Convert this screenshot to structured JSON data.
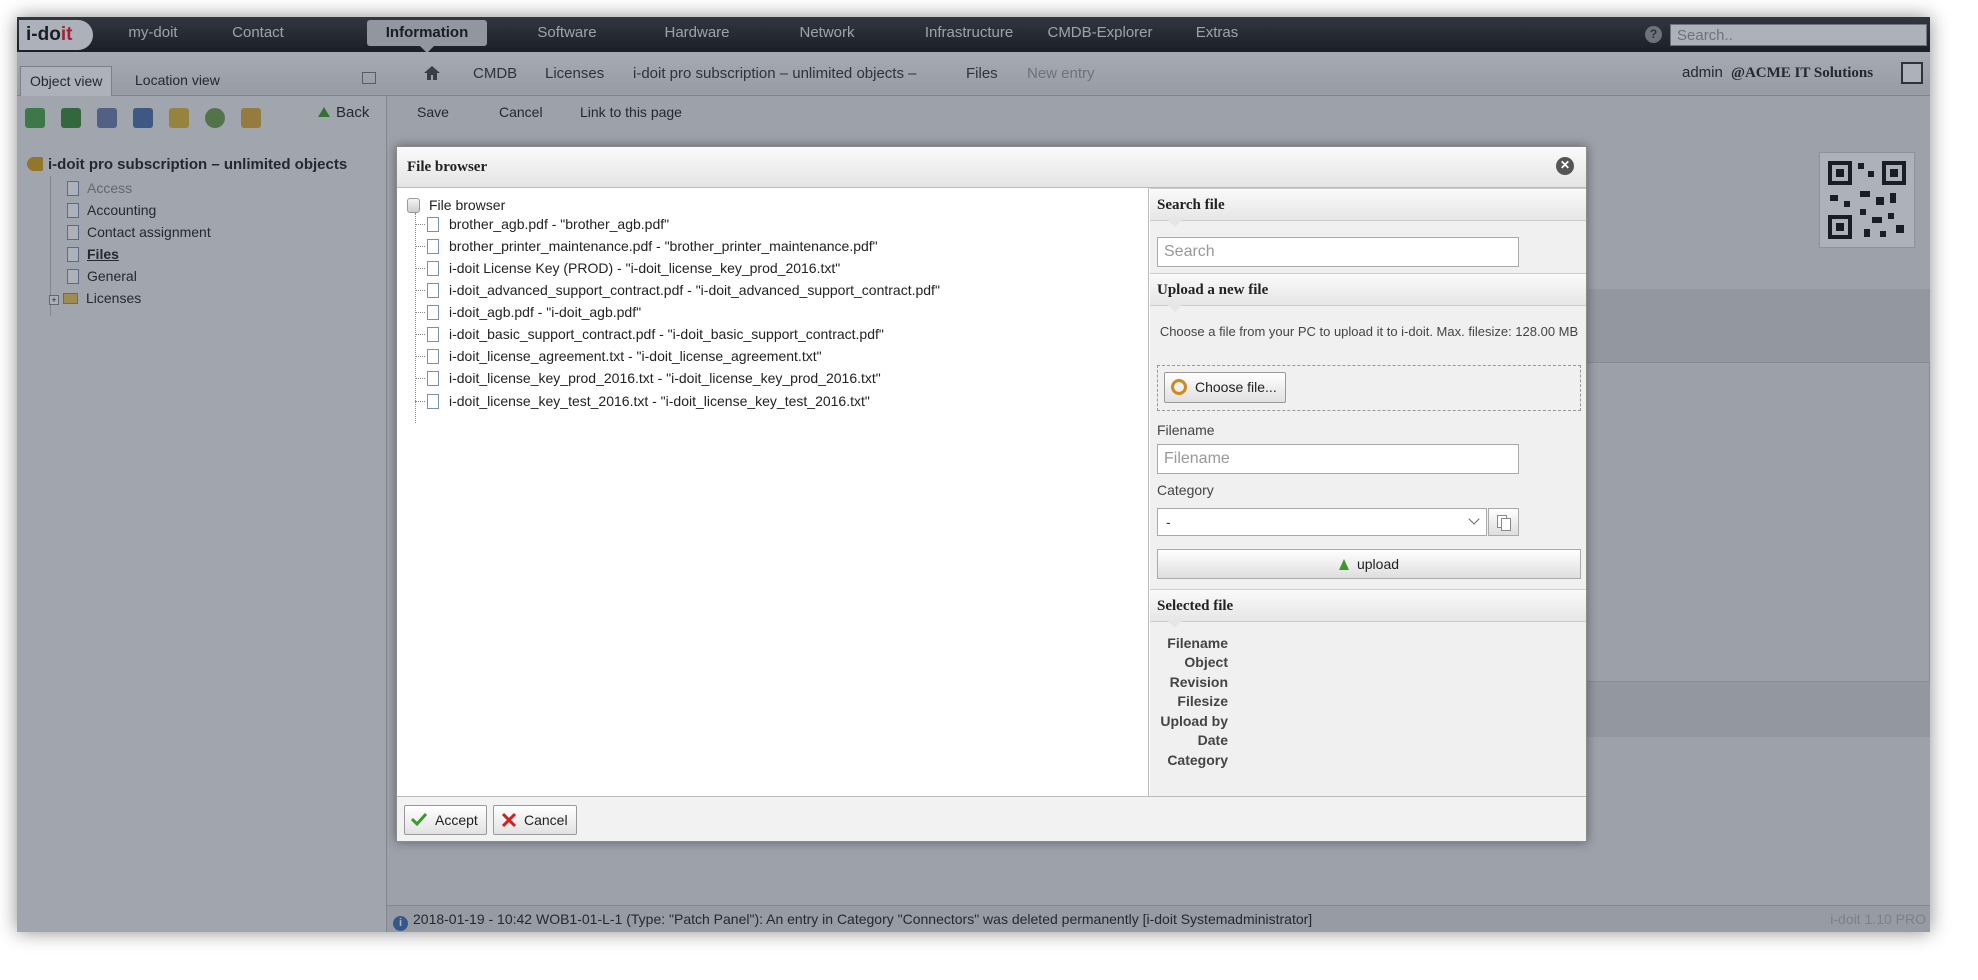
{
  "app": {
    "logo_prefix": "i-do",
    "logo_suffix": "it"
  },
  "topnav": {
    "items": [
      "my-doit",
      "Contact",
      "Information",
      "Software",
      "Hardware",
      "Network",
      "Infrastructure",
      "CMDB-Explorer",
      "Extras"
    ],
    "active": "Information",
    "search_placeholder": "Search.."
  },
  "tabs": {
    "object_view": "Object view",
    "location_view": "Location view"
  },
  "breadcrumb": [
    "CMDB",
    "Licenses",
    "i-doit pro subscription – unlimited objects –",
    "Files",
    "New entry"
  ],
  "user": {
    "name": "admin",
    "tenant": "@ACME IT Solutions"
  },
  "sidebar": {
    "back_label": "Back",
    "root_label": "i-doit pro subscription – unlimited objects",
    "items": [
      {
        "label": "Access",
        "state": "muted"
      },
      {
        "label": "Accounting",
        "state": "normal"
      },
      {
        "label": "Contact assignment",
        "state": "normal"
      },
      {
        "label": "Files",
        "state": "active"
      },
      {
        "label": "General",
        "state": "normal"
      },
      {
        "label": "Licenses",
        "state": "folder"
      }
    ]
  },
  "actions": {
    "save": "Save",
    "cancel": "Cancel",
    "link": "Link to this page"
  },
  "statusbar": {
    "message": "2018-01-19 - 10:42 WOB1-01-L-1 (Type: \"Patch Panel\"): An entry in Category \"Connectors\" was deleted permanently [i-doit Systemadministrator]",
    "version": "i-doit 1.10 PRO"
  },
  "dialog": {
    "title": "File browser",
    "root_label": "File browser",
    "files": [
      "brother_agb.pdf - \"brother_agb.pdf\"",
      "brother_printer_maintenance.pdf - \"brother_printer_maintenance.pdf\"",
      "i-doit License Key (PROD) - \"i-doit_license_key_prod_2016.txt\"",
      "i-doit_advanced_support_contract.pdf - \"i-doit_advanced_support_contract.pdf\"",
      "i-doit_agb.pdf - \"i-doit_agb.pdf\"",
      "i-doit_basic_support_contract.pdf - \"i-doit_basic_support_contract.pdf\"",
      "i-doit_license_agreement.txt - \"i-doit_license_agreement.txt\"",
      "i-doit_license_key_prod_2016.txt - \"i-doit_license_key_prod_2016.txt\"",
      "i-doit_license_key_test_2016.txt - \"i-doit_license_key_test_2016.txt\""
    ],
    "search": {
      "heading": "Search file",
      "placeholder": "Search"
    },
    "upload": {
      "heading": "Upload a new file",
      "help": "Choose a file from your PC to upload it to i-doit. Max. filesize: 128.00 MB",
      "choose_label": "Choose file...",
      "filename_label": "Filename",
      "filename_placeholder": "Filename",
      "category_label": "Category",
      "category_value": "-",
      "upload_label": "upload"
    },
    "selected": {
      "heading": "Selected file",
      "fields": [
        "Filename",
        "Object",
        "Revision",
        "Filesize",
        "Upload by",
        "Date",
        "Category"
      ]
    },
    "footer": {
      "accept": "Accept",
      "cancel": "Cancel"
    }
  }
}
